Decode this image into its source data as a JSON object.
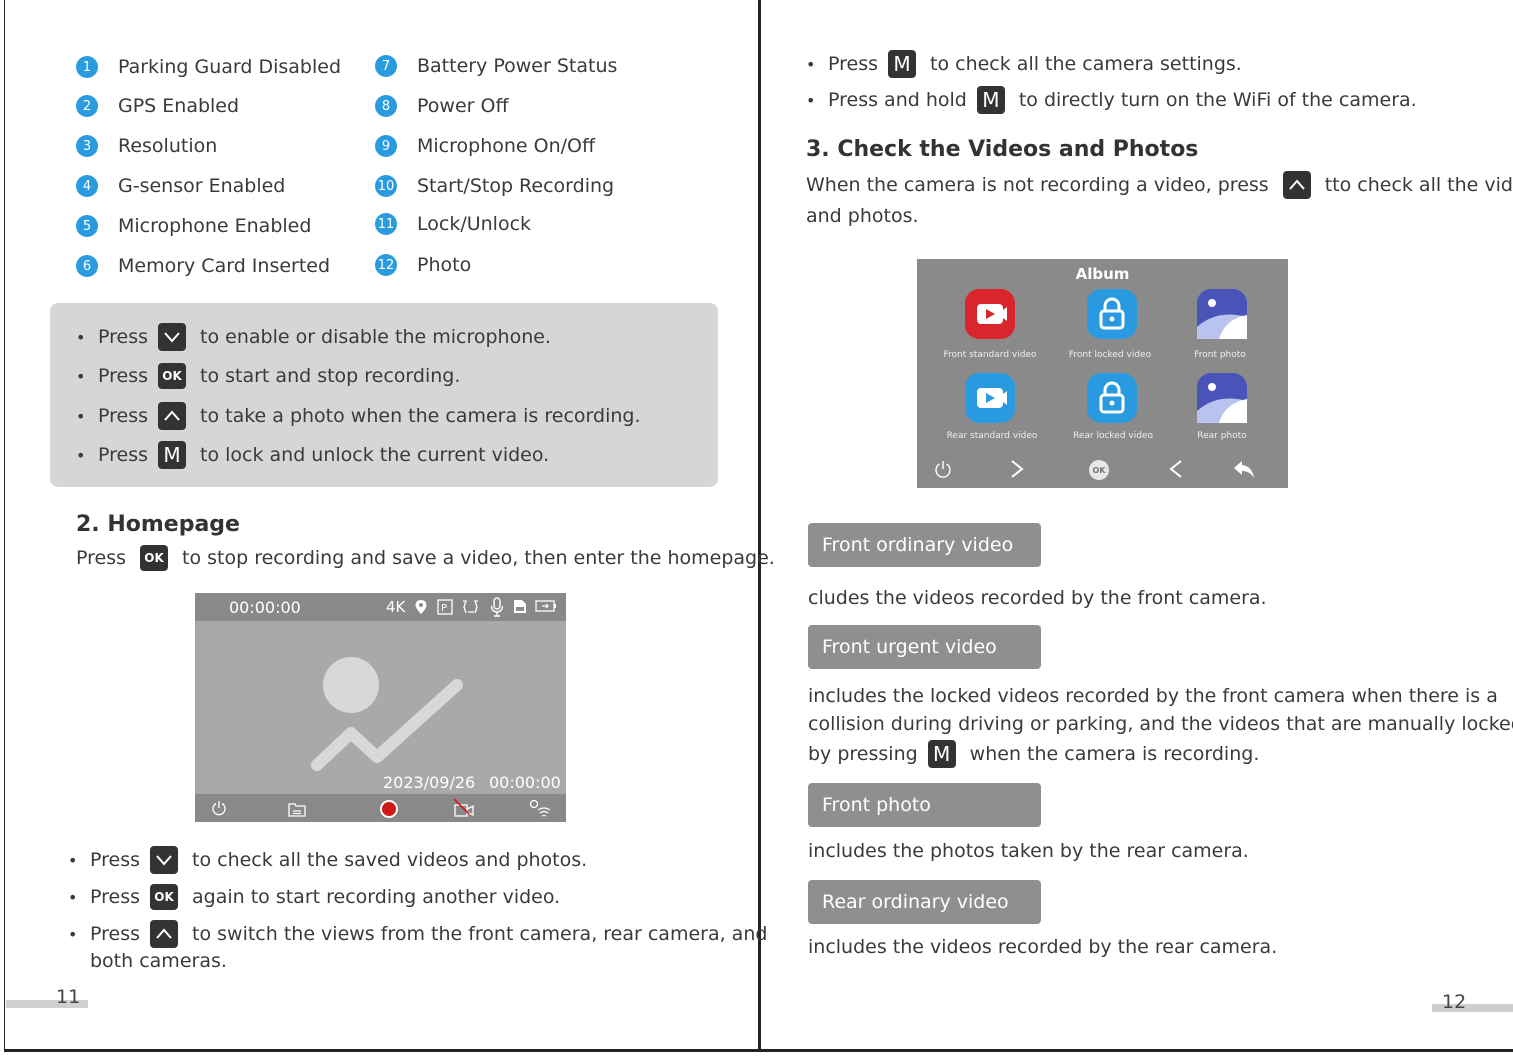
{
  "legend": {
    "left": [
      {
        "num": "1",
        "text": "Parking Guard Disabled"
      },
      {
        "num": "2",
        "text": "GPS Enabled"
      },
      {
        "num": "3",
        "text": "Resolution"
      },
      {
        "num": "4",
        "text": "G-sensor Enabled"
      },
      {
        "num": "5",
        "text": "Microphone Enabled"
      },
      {
        "num": "6",
        "text": "Memory Card Inserted"
      }
    ],
    "right": [
      {
        "num": "7",
        "text": "Battery Power Status"
      },
      {
        "num": "8",
        "text": "Power Off"
      },
      {
        "num": "9",
        "text": "Microphone On/Off"
      },
      {
        "num": "10",
        "text": "Start/Stop Recording"
      },
      {
        "num": "11",
        "text": "Lock/Unlock"
      },
      {
        "num": "12",
        "text": "Photo"
      }
    ]
  },
  "recording_tips": [
    {
      "press": "Press",
      "key": "down",
      "text": "to enable or disable the microphone."
    },
    {
      "press": "Press",
      "key": "ok",
      "text": "to start and stop recording."
    },
    {
      "press": "Press",
      "key": "up",
      "text": "to take a photo when the camera is recording."
    },
    {
      "press": "Press",
      "key": "m",
      "text": "to lock and unlock the current video."
    }
  ],
  "keys": {
    "ok": "OK",
    "m": "M"
  },
  "homepage": {
    "heading": "2. Homepage",
    "intro_press": "Press",
    "intro_text": "to stop recording and save a video, then enter the homepage.",
    "screen": {
      "time": "00:00:00",
      "resolution": "4K",
      "date": "2023/09/26",
      "timestamp": "00:00:00"
    },
    "tips": [
      {
        "press": "Press",
        "key": "down",
        "text": "to check all the saved videos and photos."
      },
      {
        "press": "Press",
        "key": "ok",
        "text": "again to start recording another video."
      },
      {
        "press": "Press",
        "key": "up",
        "text": "to switch the views from the front camera, rear camera, and"
      }
    ],
    "tips_continuation": "both cameras."
  },
  "page_left": "11",
  "page_right": "12",
  "right_tips": [
    {
      "press": "Press",
      "key": "m",
      "text": "to check all the camera settings."
    },
    {
      "press": "Press and hold",
      "key": "m",
      "text": "to directly turn on the WiFi of the camera."
    }
  ],
  "videos_section": {
    "heading": "3. Check the Videos and Photos",
    "intro_a": "When the camera is not recording a video, press",
    "intro_b": "tto check all the videos",
    "intro_c": "and photos."
  },
  "album": {
    "title": "Album",
    "items": [
      {
        "label": "Front standard video",
        "icon": "video-icon",
        "color": "#d9262c"
      },
      {
        "label": "Front locked video",
        "icon": "lock-icon",
        "color": "#2a9ae0"
      },
      {
        "label": "Front photo",
        "icon": "photo-icon",
        "color": "#4a54b8"
      },
      {
        "label": "Rear standard video",
        "icon": "video-icon",
        "color": "#2a9ae0"
      },
      {
        "label": "Rear locked video",
        "icon": "lock-icon",
        "color": "#2a9ae0"
      },
      {
        "label": "Rear photo",
        "icon": "photo-icon",
        "color": "#4a54b8"
      }
    ],
    "nav_ok": "OK"
  },
  "categories": [
    {
      "tag": "Front ordinary video",
      "desc": [
        "cludes the videos recorded by the front camera."
      ]
    },
    {
      "tag": "Front urgent video",
      "desc": [
        "includes the locked videos recorded by the front camera when there is a",
        "collision during driving or parking, and the videos that are manually locked"
      ],
      "desc_last_a": "by pressing",
      "desc_last_b": "when the camera is recording."
    },
    {
      "tag": "Front photo",
      "desc": [
        "includes the photos taken by the rear camera."
      ]
    },
    {
      "tag": "Rear ordinary video",
      "desc": [
        "includes the videos recorded by the rear camera."
      ]
    }
  ],
  "colors": {
    "accent": "#2b9be0",
    "tag_bg": "#8f8f8f",
    "box_bg": "#d4d6d8",
    "key_bg": "#333333"
  }
}
